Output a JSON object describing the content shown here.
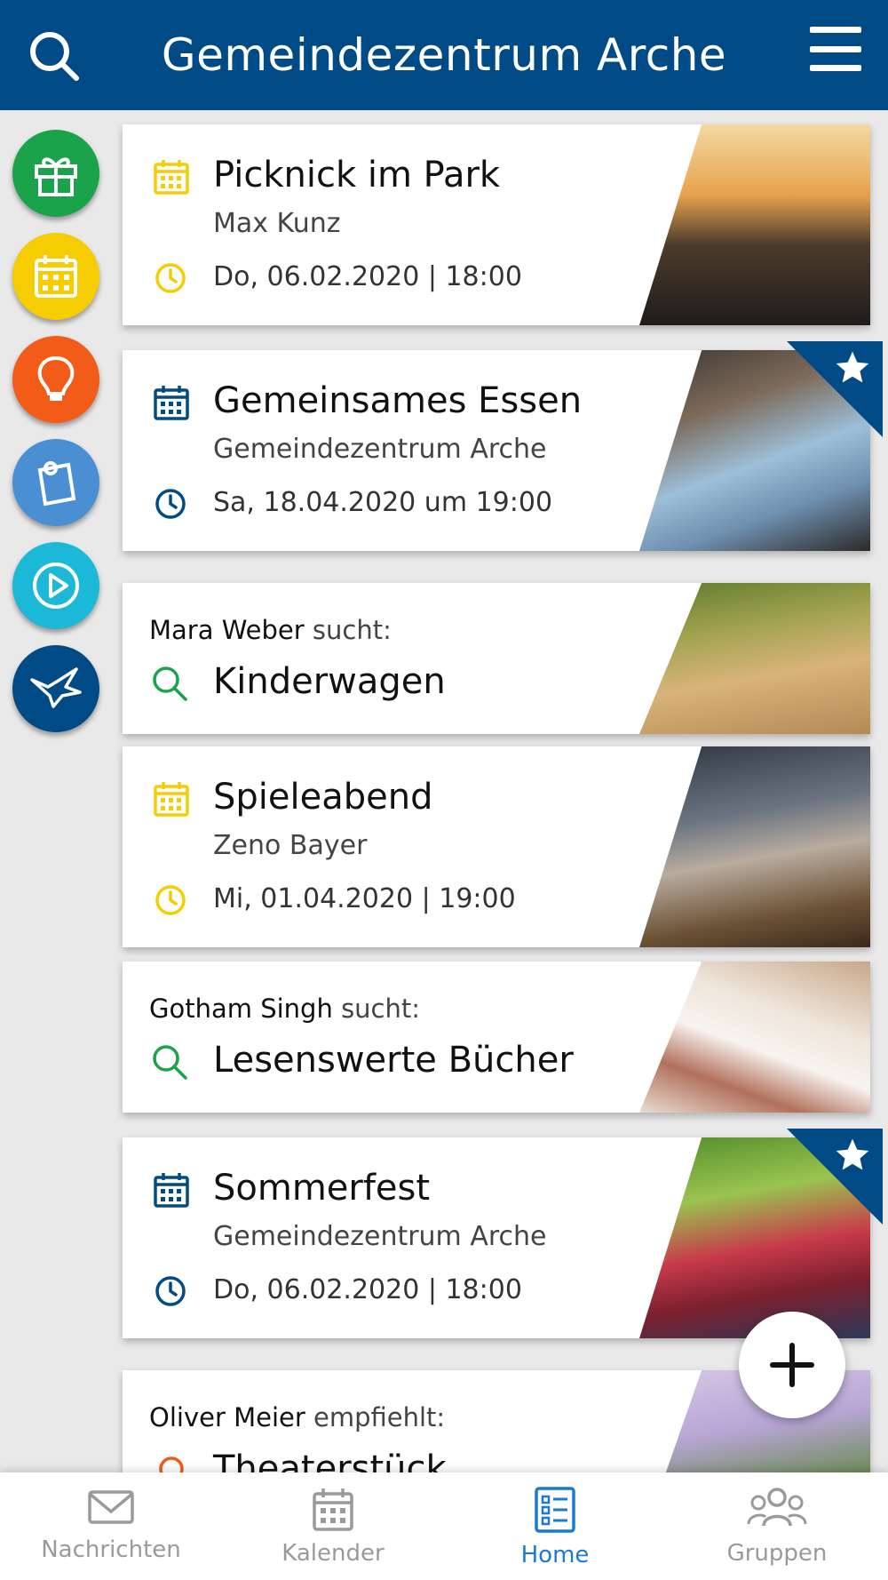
{
  "header": {
    "title": "Gemeindezentrum Arche"
  },
  "side_bubbles": [
    {
      "name": "gift",
      "color": "#1aa34a"
    },
    {
      "name": "calendar",
      "color": "#f6cd00"
    },
    {
      "name": "lightbulb",
      "color": "#f25b18"
    },
    {
      "name": "pin-note",
      "color": "#4a8fd2"
    },
    {
      "name": "play",
      "color": "#1cb8d8"
    },
    {
      "name": "dove",
      "color": "#004b85"
    }
  ],
  "feed": [
    {
      "type": "event",
      "title": "Picknick im Park",
      "organizer": "Max Kunz",
      "datetime": "Do, 06.02.2020 | 18:00",
      "icon_color": "#f6cd00",
      "featured": false
    },
    {
      "type": "event",
      "title": "Gemeinsames Essen",
      "organizer": "Gemeindezentrum Arche",
      "datetime": "Sa, 18.04.2020 um 19:00",
      "icon_color": "#004b85",
      "featured": true
    },
    {
      "type": "search",
      "person": "Mara Weber",
      "verb": "sucht:",
      "item": "Kinderwagen"
    },
    {
      "type": "event",
      "title": "Spieleabend",
      "organizer": "Zeno Bayer",
      "datetime": "Mi, 01.04.2020 | 19:00",
      "icon_color": "#f6cd00",
      "featured": false
    },
    {
      "type": "search",
      "person": "Gotham Singh",
      "verb": "sucht:",
      "item": "Lesenswerte Bücher"
    },
    {
      "type": "event",
      "title": "Sommerfest",
      "organizer": "Gemeindezentrum Arche",
      "datetime": "Do, 06.02.2020 | 18:00",
      "icon_color": "#004b85",
      "featured": true
    },
    {
      "type": "recommend",
      "person": "Oliver Meier",
      "verb": "empfiehlt:",
      "item": "Theaterstück"
    }
  ],
  "bottom_nav": [
    {
      "label": "Nachrichten",
      "icon": "envelope-icon",
      "active": false
    },
    {
      "label": "Kalender",
      "icon": "calendar-icon",
      "active": false
    },
    {
      "label": "Home",
      "icon": "list-icon",
      "active": true
    },
    {
      "label": "Gruppen",
      "icon": "group-icon",
      "active": false
    }
  ],
  "colors": {
    "primary": "#004b85",
    "active_nav": "#1a7ad4",
    "search_green": "#1aa34a",
    "event_yellow": "#f6cd00"
  }
}
